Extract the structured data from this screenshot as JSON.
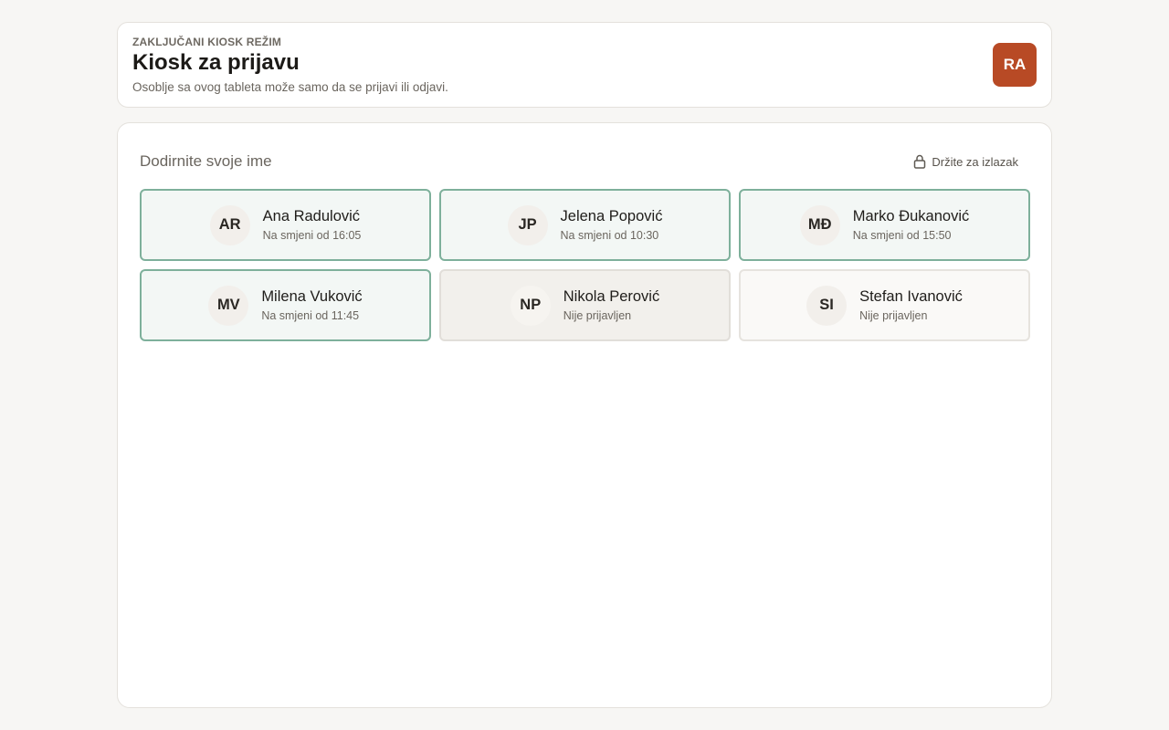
{
  "header": {
    "mode_label": "ZAKLJUČANI KIOSK REŽIM",
    "title": "Kiosk za prijavu",
    "subtitle": "Osoblje sa ovog tableta može samo da se prijavi ili odjavi.",
    "avatar_initials": "RA",
    "avatar_color": "#b84a25"
  },
  "main": {
    "section_title": "Dodirnite svoje ime",
    "exit_label": "Držite za izlazak",
    "exit_icon": "lock-icon"
  },
  "staff": [
    {
      "initials": "AR",
      "name": "Ana Radulović",
      "status": "Na smjeni od 16:05"
    },
    {
      "initials": "JP",
      "name": "Jelena Popović",
      "status": "Na smjeni od 10:30"
    },
    {
      "initials": "MĐ",
      "name": "Marko Đukanović",
      "status": "Na smjeni od 15:50"
    },
    {
      "initials": "MV",
      "name": "Milena Vuković",
      "status": "Na smjeni od 11:45"
    },
    {
      "initials": "NP",
      "name": "Nikola Perović",
      "status": "Nije prijavljen"
    },
    {
      "initials": "SI",
      "name": "Stefan Ivanović",
      "status": "Nije prijavljen"
    }
  ],
  "colors": {
    "on_shift_border": "#7eb09b",
    "on_shift_bg": "#f3f7f5",
    "accent": "#b84a25"
  }
}
